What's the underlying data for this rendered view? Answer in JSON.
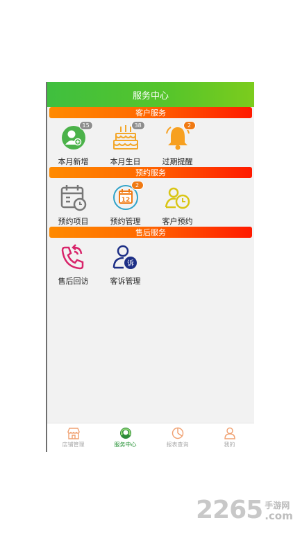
{
  "header": {
    "title": "服务中心"
  },
  "sections": [
    {
      "title": "客户服务",
      "items": [
        {
          "label": "本月新增",
          "badge": "15",
          "icon": "new-customer-icon"
        },
        {
          "label": "本月生日",
          "badge": "38",
          "icon": "birthday-cake-icon"
        },
        {
          "label": "过期提醒",
          "badge": "2",
          "icon": "bell-icon"
        }
      ]
    },
    {
      "title": "预约服务",
      "items": [
        {
          "label": "预约项目",
          "icon": "calendar-clock-icon"
        },
        {
          "label": "预约管理",
          "badge": "2",
          "icon": "calendar-12-icon"
        },
        {
          "label": "客户预约",
          "icon": "customer-clock-icon"
        }
      ]
    },
    {
      "title": "售后服务",
      "items": [
        {
          "label": "售后回访",
          "icon": "phone-callback-icon"
        },
        {
          "label": "客诉管理",
          "icon": "complaint-user-icon"
        }
      ]
    }
  ],
  "tabbar": {
    "items": [
      {
        "label": "店铺管理",
        "icon": "store-icon"
      },
      {
        "label": "服务中心",
        "icon": "headset-icon",
        "active": true
      },
      {
        "label": "报表查询",
        "icon": "report-pie-icon"
      },
      {
        "label": "我的",
        "icon": "user-icon"
      }
    ]
  },
  "watermark": {
    "number": "2265",
    "cn": "手游网",
    "domain": ".com"
  },
  "colors": {
    "green": "#4cc13a",
    "orange": "#ff7a00",
    "red": "#ff1a00"
  }
}
